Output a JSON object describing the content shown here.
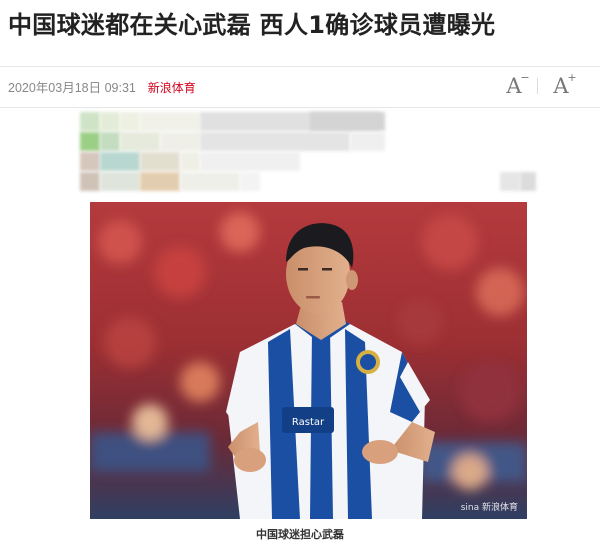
{
  "article": {
    "headline": "中国球迷都在关心武磊 西人1确诊球员遭曝光",
    "date": "2020年03月18日 09:31",
    "source": "新浪体育",
    "image_caption": "中国球迷担心武磊"
  },
  "toolbar": {
    "font_decrease": {
      "glyph": "A",
      "sign": "−",
      "icon": "font-decrease-icon"
    },
    "font_increase": {
      "glyph": "A",
      "sign": "+",
      "icon": "font-increase-icon"
    }
  },
  "photo": {
    "watermark": "sina 新浪体育",
    "jersey_text": "Rastar"
  },
  "colors": {
    "source_link": "#d0021b",
    "headline": "#222222",
    "meta": "#888888",
    "jersey_blue": "#1b4fa3",
    "crowd_red": "#b23b3b"
  }
}
